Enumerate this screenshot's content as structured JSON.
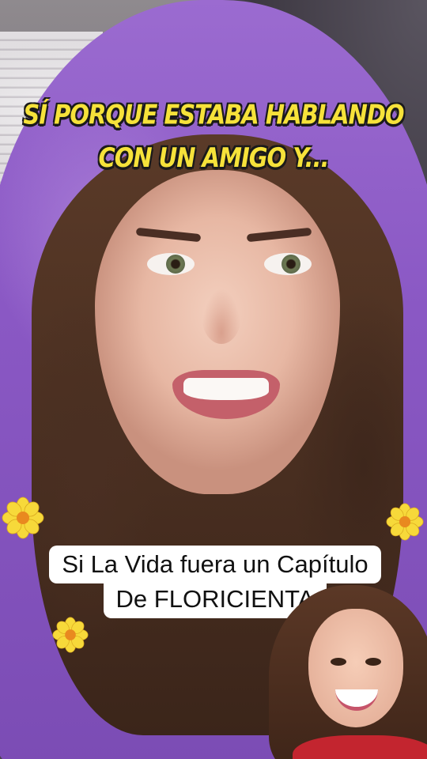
{
  "caption": {
    "line1": "SÍ PORQUE ESTABA HABLANDO",
    "line2": "CON UN AMIGO Y..."
  },
  "title_overlay": {
    "line1": "Si La Vida fuera un Capítulo",
    "line2": "De FLORICIENTA"
  },
  "decorations": {
    "flower_icon": "daisy-icon",
    "flower_color": "#f7d93a",
    "flower_center_color": "#e9891f"
  },
  "colors": {
    "caption_text": "#f6e23a",
    "caption_outline": "#1a1a1a",
    "hoodie": "#8a58c4",
    "title_background": "#ffffff",
    "title_text": "#111111"
  }
}
